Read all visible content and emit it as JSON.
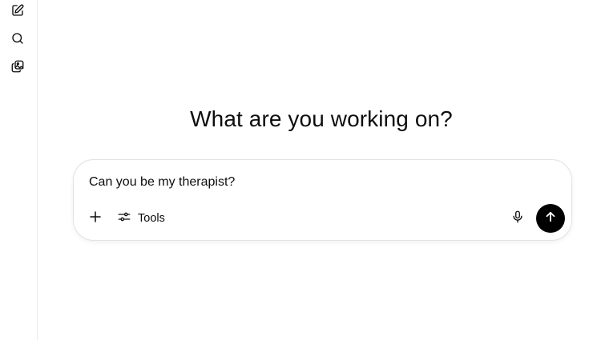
{
  "sidebar": {
    "items": [
      {
        "name": "new-chat",
        "icon": "pencil-square-icon"
      },
      {
        "name": "search-chats",
        "icon": "search-icon"
      },
      {
        "name": "library",
        "icon": "image-library-icon"
      }
    ]
  },
  "main": {
    "heading": "What are you working on?"
  },
  "composer": {
    "input_value": "Can you be my therapist?",
    "placeholder": "",
    "tools_label": "Tools",
    "icons": {
      "add": "plus-icon",
      "tools": "sliders-icon",
      "mic": "microphone-icon",
      "send": "arrow-up-icon"
    }
  },
  "colors": {
    "text": "#0d0d0d",
    "border": "#e3e3e3",
    "send_background": "#000000",
    "send_icon": "#ffffff"
  }
}
